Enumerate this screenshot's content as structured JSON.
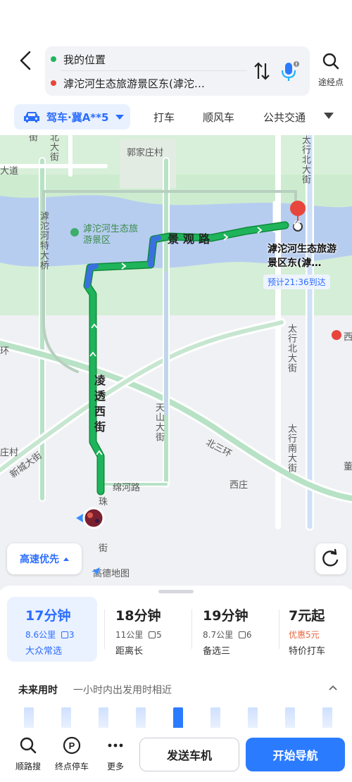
{
  "header": {
    "origin": "我的位置",
    "destination": "滹沱河生态旅游景区东(滹沱…",
    "via_label": "途经点"
  },
  "modes": {
    "drive_label": "驾车·冀A**5",
    "tabs": [
      "打车",
      "顺风车",
      "公共交通"
    ]
  },
  "map": {
    "labels": {
      "north_street_top": "北大街",
      "street_top_left": "街",
      "guojiazhuang": "郭家庄村",
      "road_left": "大道",
      "taihang_north_top": "太行北大街",
      "scenic_area": "滹沱河生态旅游景区",
      "hutuo_bridge": "滹沱河特大桥",
      "jingguan_road": "景观路",
      "lingtou_west": "凌透西街",
      "tianshan_street": "天山大街",
      "north_third_ring": "北三环",
      "xincheng_street": "新城大街",
      "mianhe_road": "绵河路",
      "xizhuang": "西庄",
      "taihang_north_mid": "太行北大街",
      "taihang_south": "太行南大街",
      "zhu_street": "珠",
      "street_bottom": "街",
      "huan_left": "环",
      "zhuang_left": "庄村",
      "xi_right": "西",
      "dong_right": "董"
    },
    "destination_label": "滹沱河生态旅游景区东(滹…",
    "end_marker": "终",
    "eta": "预计21:36到达",
    "preference": "高速优先",
    "brand": "高德地图",
    "colors": {
      "route": "#1fb45b",
      "route_slow": "#3a6fe0",
      "river": "#b7cdf0",
      "park": "#cdeccf",
      "accent": "#2b7bff"
    }
  },
  "routes": [
    {
      "time": "17分钟",
      "distance": "8.6公里",
      "lights": "3",
      "tag": "大众常选"
    },
    {
      "time": "18分钟",
      "distance": "11公里",
      "lights": "5",
      "tag": "距离长"
    },
    {
      "time": "19分钟",
      "distance": "8.7公里",
      "lights": "6",
      "tag": "备选三"
    },
    {
      "time": "7元起",
      "distance": "优惠5元",
      "lights": "",
      "tag": "特价打车"
    }
  ],
  "future": {
    "title": "未来用时",
    "hint": "一小时内出发用时相近",
    "bar_levels": [
      0.85,
      0.85,
      0.85,
      0.85,
      0.85,
      0.85,
      0.85,
      0.85,
      0.85
    ],
    "current_index": 4
  },
  "actions": {
    "along_search": "顺路搜",
    "end_parking": "终点停车",
    "more": "更多",
    "send_to_car": "发送车机",
    "start_nav": "开始导航"
  }
}
